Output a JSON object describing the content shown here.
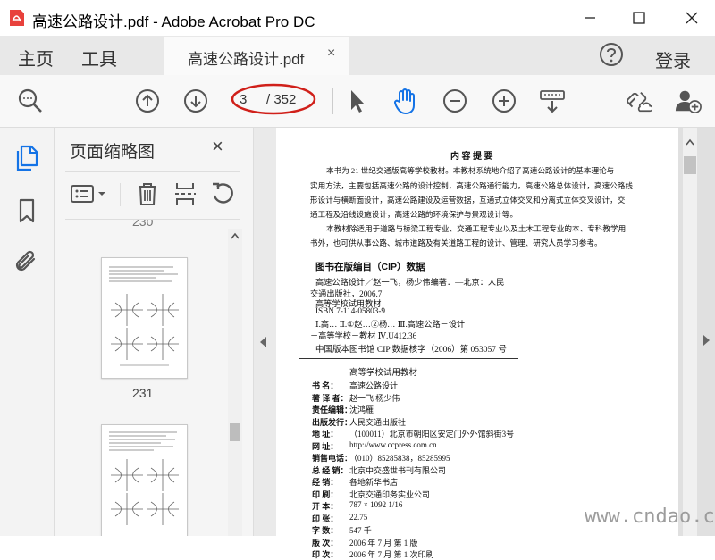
{
  "window": {
    "title": "高速公路设计.pdf - Adobe Acrobat Pro DC",
    "app_icon": "acrobat-logo-icon",
    "controls": [
      "minimize-icon",
      "maximize-icon",
      "close-icon"
    ]
  },
  "nav": {
    "home": "主页",
    "tools": "工具",
    "help_icon": "question-icon",
    "login": "登录"
  },
  "tab": {
    "label": "高速公路设计.pdf",
    "close": "×"
  },
  "toolbar": {
    "tools": [
      "search-zoom-icon",
      "page-up-icon",
      "page-down-icon",
      "select-cursor-icon",
      "hand-tool-icon",
      "zoom-out-icon",
      "zoom-in-icon",
      "keyboard-scroll-icon",
      "share-link-icon",
      "add-user-icon"
    ],
    "page_current": "3",
    "page_total": "/ 352",
    "highlight_color": "#d0201a"
  },
  "rail": {
    "items": [
      "page-thumbnails-icon",
      "bookmark-icon",
      "attachment-icon"
    ],
    "accent": "#1473e6"
  },
  "panel": {
    "title": "页面缩略图",
    "close": "×",
    "tools": [
      "options-menu-icon",
      "delete-icon",
      "crop-icon",
      "rotate-icon"
    ],
    "partial_label": "230",
    "thumbnails": [
      {
        "label": "231"
      }
    ]
  },
  "document": {
    "heading": "内  容  提  要",
    "intro_lines": [
      "本书为 21 世纪交通版高等学校教材。本教材系统地介绍了高速公路设计的基本理论与",
      "实用方法，主要包括高速公路的设计控制，高速公路通行能力，高速公路总体设计，高速公路线",
      "形设计与横断面设计，高速公路建设及运营数据，互通式立体交叉和分离式立体交叉设计，交",
      "通工程及沿线设施设计，高速公路的环境保护与景观设计等。",
      "本教材除适用于道路与桥梁工程专业、交通工程专业以及土木工程专业的本、专科教学用",
      "书外，也可供从事公路、城市道路及有关道路工程的设计、管理、研究人员学习参考。"
    ],
    "cip_title": "图书在版编目（CIP）数据",
    "cip_lines": [
      "高速公路设计／赵一飞，杨少伟编著．—北京：人民",
      "交通出版社，2006.7",
      "高等学校试用教材",
      "ISBN 7-114-05803-9",
      "Ⅰ.高…  Ⅱ.①赵…②杨…  Ⅲ.高速公路－设计",
      "－高等学校－教材  Ⅳ.U412.36"
    ],
    "cip_number": "中国版本图书馆 CIP 数据核字（2006）第 053057 号",
    "series_label": "高等学校试用教材",
    "info": [
      {
        "k": "书    名：",
        "v": "高速公路设计"
      },
      {
        "k": "著 译 者：",
        "v": "赵一飞    杨少伟"
      },
      {
        "k": "责任编辑：",
        "v": "沈鸿雁"
      },
      {
        "k": "出版发行：",
        "v": "人民交通出版社"
      },
      {
        "k": "地    址：",
        "v": "（100011）北京市朝阳区安定门外外馆斜街3号"
      },
      {
        "k": "网    址：",
        "v": "http://www.ccpress.com.cn"
      },
      {
        "k": "销售电话：",
        "v": "（010）85285838，85285995"
      },
      {
        "k": "总 经 销：",
        "v": "北京中交盛世书刊有限公司"
      },
      {
        "k": "经    销：",
        "v": "各地新华书店"
      },
      {
        "k": "印    刷：",
        "v": "北京交通印务实业公司"
      },
      {
        "k": "开    本：",
        "v": "787 × 1092  1/16"
      },
      {
        "k": "印    张：",
        "v": "22.75"
      },
      {
        "k": "字    数：",
        "v": "547 千"
      },
      {
        "k": "版    次：",
        "v": "2006 年 7 月  第 1 版"
      },
      {
        "k": "印    次：",
        "v": "2006 年 7 月  第 1 次印刷"
      }
    ]
  },
  "watermark": "www.cndao.com"
}
